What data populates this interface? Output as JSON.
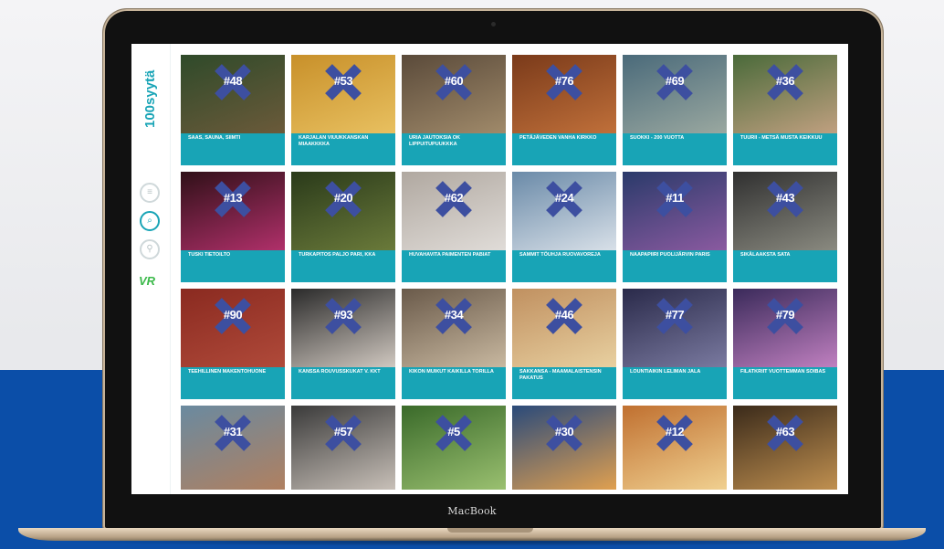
{
  "app": {
    "logo_text": "100syytä",
    "device_label": "MacBook",
    "sidebar": {
      "icons": [
        "menu-icon",
        "search-icon",
        "location-icon"
      ],
      "partner_logo": "VR"
    }
  },
  "colors": {
    "accent": "#18a4b6",
    "cross": "#3d4fa0",
    "band": "#0b4ea8"
  },
  "cards": [
    {
      "num": "#48",
      "caption": "SAAS, SAUNA, SIIMTI",
      "bg": [
        "#2f4a2a",
        "#6b5a3a"
      ]
    },
    {
      "num": "#53",
      "caption": "KARJALAN VIUUKKANSKAN MIAAKKKKA",
      "bg": [
        "#c8902a",
        "#e8c060"
      ]
    },
    {
      "num": "#60",
      "caption": "URIA JAUTOKSIA OK LIPPUITUPUUKKKA",
      "bg": [
        "#5a4a3a",
        "#a08a6a"
      ]
    },
    {
      "num": "#76",
      "caption": "PETÄJÄVEDEN VANHA KIRKKO",
      "bg": [
        "#7a3a1a",
        "#c0703a"
      ]
    },
    {
      "num": "#69",
      "caption": "SUOKKI - 200 VUOTTA",
      "bg": [
        "#4a6a7a",
        "#9aa8a0"
      ]
    },
    {
      "num": "#36",
      "caption": "TUURII - METSÄ MUSTA KEIKKUU",
      "bg": [
        "#4a6a3a",
        "#c0a080"
      ]
    },
    {
      "num": "#13",
      "caption": "TUSKI TIETOILTO",
      "bg": [
        "#301018",
        "#b0306a"
      ]
    },
    {
      "num": "#20",
      "caption": "TURKAPITOS PALJO PARI, KKA",
      "bg": [
        "#2a3a1a",
        "#6a7a3a"
      ]
    },
    {
      "num": "#62",
      "caption": "HUVAHAVITA PAIMENTEN PABIAT",
      "bg": [
        "#b0a8a0",
        "#e0dcd8"
      ]
    },
    {
      "num": "#24",
      "caption": "SAMMIT TÖUHJA RUOVAVOREJA",
      "bg": [
        "#6a8aa8",
        "#d8e0e8"
      ]
    },
    {
      "num": "#11",
      "caption": "NAAPAPIIRI PUOLIJÄRVIN PARIS",
      "bg": [
        "#2a3a6a",
        "#8a5aa0"
      ]
    },
    {
      "num": "#43",
      "caption": "SIKÄLAAKSTA SATA",
      "bg": [
        "#303030",
        "#8a8a80"
      ]
    },
    {
      "num": "#90",
      "caption": "TEEHILLINEN MAKENTOHUONE",
      "bg": [
        "#8a2a20",
        "#b04a3a"
      ]
    },
    {
      "num": "#93",
      "caption": "KANSSA ROUVUSSKUKAT V. KKT",
      "bg": [
        "#2a2a2a",
        "#d0c8c0"
      ]
    },
    {
      "num": "#34",
      "caption": "KIKON MUIKUT KAIKILLA TORILLA",
      "bg": [
        "#6a5a4a",
        "#c8b8a0"
      ]
    },
    {
      "num": "#46",
      "caption": "SAKKANSA - MAAMALAISTENSIN PAKATUS",
      "bg": [
        "#c09060",
        "#e8d0a0"
      ]
    },
    {
      "num": "#77",
      "caption": "LOUNTIAIKIN LELIMAN JALA",
      "bg": [
        "#2a2a4a",
        "#7a7aa0"
      ]
    },
    {
      "num": "#79",
      "caption": "FILATKRIIT VUOTTEMMAN SOIBAS",
      "bg": [
        "#3a2a5a",
        "#c080c0"
      ]
    },
    {
      "num": "#31",
      "caption": "",
      "bg": [
        "#6a8aa0",
        "#b08060"
      ]
    },
    {
      "num": "#57",
      "caption": "",
      "bg": [
        "#3a3a3a",
        "#c8c0b8"
      ]
    },
    {
      "num": "#5",
      "caption": "",
      "bg": [
        "#3a6a2a",
        "#9ac070"
      ]
    },
    {
      "num": "#30",
      "caption": "",
      "bg": [
        "#2a4a7a",
        "#e0a050"
      ]
    },
    {
      "num": "#12",
      "caption": "",
      "bg": [
        "#c07030",
        "#f0d090"
      ]
    },
    {
      "num": "#63",
      "caption": "",
      "bg": [
        "#3a2a1a",
        "#c09050"
      ]
    }
  ]
}
